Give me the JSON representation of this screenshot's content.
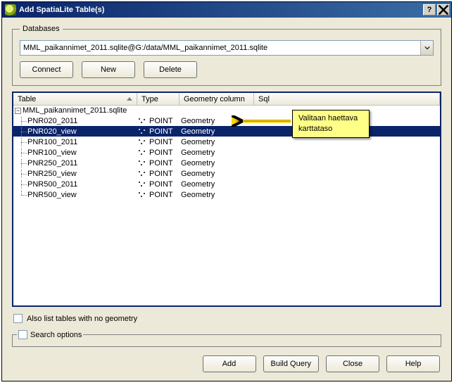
{
  "window": {
    "title": "Add SpatiaLite Table(s)"
  },
  "databases": {
    "legend": "Databases",
    "selected": "MML_paikannimet_2011.sqlite@G:/data/MML_paikannimet_2011.sqlite",
    "buttons": {
      "connect": "Connect",
      "new": "New",
      "delete": "Delete"
    }
  },
  "columns": {
    "table": "Table",
    "type": "Type",
    "geom": "Geometry column",
    "sql": "Sql"
  },
  "db_node": "MML_paikannimet_2011.sqlite",
  "rows": [
    {
      "name": "PNR020_2011",
      "type": "POINT",
      "geom": "Geometry",
      "selected": false
    },
    {
      "name": "PNR020_view",
      "type": "POINT",
      "geom": "Geometry",
      "selected": true
    },
    {
      "name": "PNR100_2011",
      "type": "POINT",
      "geom": "Geometry",
      "selected": false
    },
    {
      "name": "PNR100_view",
      "type": "POINT",
      "geom": "Geometry",
      "selected": false
    },
    {
      "name": "PNR250_2011",
      "type": "POINT",
      "geom": "Geometry",
      "selected": false
    },
    {
      "name": "PNR250_view",
      "type": "POINT",
      "geom": "Geometry",
      "selected": false
    },
    {
      "name": "PNR500_2011",
      "type": "POINT",
      "geom": "Geometry",
      "selected": false
    },
    {
      "name": "PNR500_view",
      "type": "POINT",
      "geom": "Geometry",
      "selected": false
    }
  ],
  "checkbox_nogeom": "Also list tables with no geometry",
  "search_options_label": "Search options",
  "footer": {
    "add": "Add",
    "build_query": "Build Query",
    "close": "Close",
    "help": "Help"
  },
  "annotation": {
    "text1": "Valitaan  haettava",
    "text2": "karttataso"
  }
}
